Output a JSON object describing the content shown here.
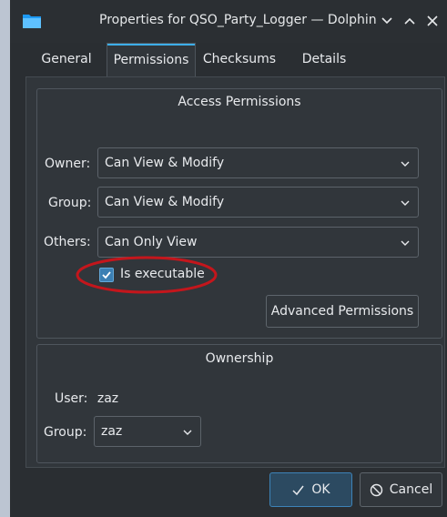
{
  "window": {
    "title": "Properties for QSO_Party_Logger — Dolphin",
    "icons": {
      "app": "folder-icon",
      "minimize": "chevron-down-icon",
      "maximize": "chevron-up-icon",
      "close": "close-icon"
    }
  },
  "tabs": [
    {
      "label": "General",
      "active": false
    },
    {
      "label": "Permissions",
      "active": true
    },
    {
      "label": "Checksums",
      "active": false
    },
    {
      "label": "Details",
      "active": false
    }
  ],
  "access": {
    "title": "Access Permissions",
    "owner_label": "Owner:",
    "owner_value": "Can View & Modify",
    "group_label": "Group:",
    "group_value": "Can View & Modify",
    "others_label": "Others:",
    "others_value": "Can Only View",
    "executable_label": "Is executable",
    "executable_checked": true,
    "advanced_label": "Advanced Permissions"
  },
  "ownership": {
    "title": "Ownership",
    "user_label": "User:",
    "user_value": "zaz",
    "group_label": "Group:",
    "group_value": "zaz"
  },
  "footer": {
    "ok_label": "OK",
    "cancel_label": "Cancel"
  },
  "colors": {
    "accent": "#3daee9",
    "annotation": "#c4161c",
    "window_bg": "#2a2e32"
  }
}
